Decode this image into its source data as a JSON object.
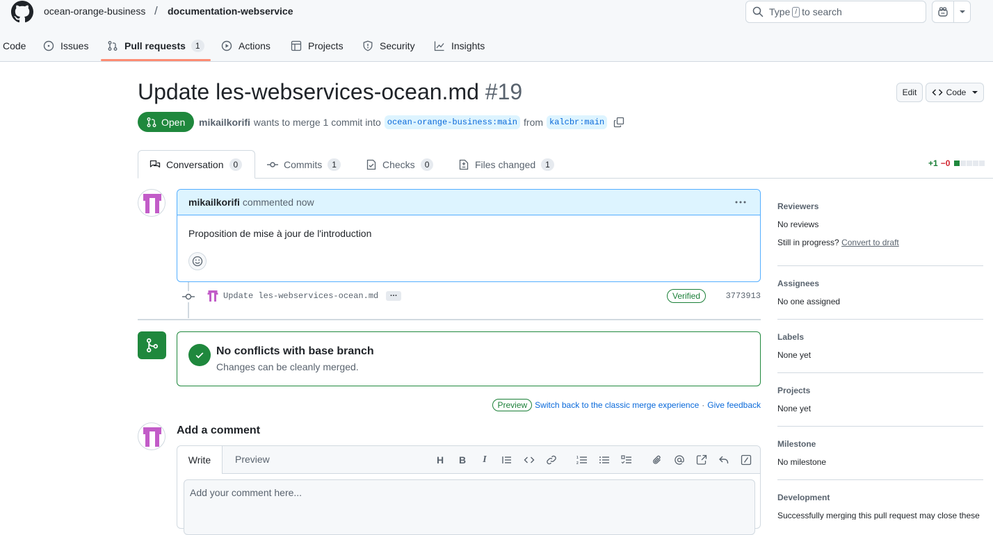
{
  "header": {
    "owner": "ocean-orange-business",
    "separator": "/",
    "repo": "documentation-webservice",
    "search_prefix": "Type",
    "search_key": "/",
    "search_suffix": "to search"
  },
  "repo_tabs": [
    {
      "label": "Code"
    },
    {
      "label": "Issues"
    },
    {
      "label": "Pull requests",
      "count": "1"
    },
    {
      "label": "Actions"
    },
    {
      "label": "Projects"
    },
    {
      "label": "Security"
    },
    {
      "label": "Insights"
    }
  ],
  "pr": {
    "title": "Update les-webservices-ocean.md",
    "number": "#19",
    "edit_label": "Edit",
    "code_label": "Code",
    "state": "Open",
    "author": "mikailkorifi",
    "merge_text": "wants to merge 1 commit into",
    "base_branch": "ocean-orange-business:main",
    "from_text": "from",
    "head_branch": "kalcbr:main"
  },
  "pr_tabs": [
    {
      "label": "Conversation",
      "count": "0"
    },
    {
      "label": "Commits",
      "count": "1"
    },
    {
      "label": "Checks",
      "count": "0"
    },
    {
      "label": "Files changed",
      "count": "1"
    }
  ],
  "diffstat": {
    "additions": "+1",
    "deletions": "−0",
    "colors": {
      "add": "#1f883d",
      "neutral": "#e6eaef"
    }
  },
  "comment": {
    "author": "mikailkorifi",
    "meta": "commented now",
    "body": "Proposition de mise à jour de l'introduction"
  },
  "commit": {
    "message": "Update les-webservices-ocean.md",
    "more": "…",
    "verified": "Verified",
    "sha": "3773913"
  },
  "merge": {
    "title": "No conflicts with base branch",
    "subtitle": "Changes can be cleanly merged.",
    "preview_badge": "Preview",
    "switch_link": "Switch back to the classic merge experience",
    "separator": "·",
    "feedback_link": "Give feedback"
  },
  "add_comment": {
    "title": "Add a comment",
    "write_tab": "Write",
    "preview_tab": "Preview",
    "placeholder": "Add your comment here..."
  },
  "sidebar": {
    "reviewers": {
      "heading": "Reviewers",
      "value": "No reviews",
      "progress_text": "Still in progress?",
      "draft_link": "Convert to draft"
    },
    "assignees": {
      "heading": "Assignees",
      "value": "No one assigned"
    },
    "labels": {
      "heading": "Labels",
      "value": "None yet"
    },
    "projects": {
      "heading": "Projects",
      "value": "None yet"
    },
    "milestone": {
      "heading": "Milestone",
      "value": "No milestone"
    },
    "development": {
      "heading": "Development",
      "value": "Successfully merging this pull request may close these"
    }
  },
  "colors": {
    "accent": "#0969da",
    "success": "#1f883d",
    "tab_underline": "#fd8c73",
    "avatar": "#c25cc8"
  }
}
